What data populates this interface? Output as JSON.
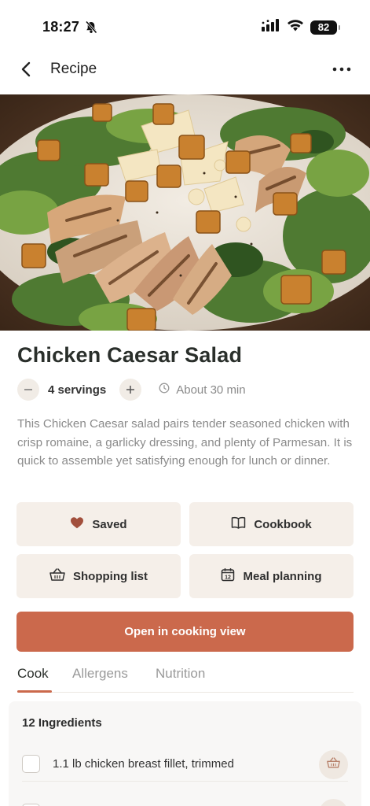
{
  "status_bar": {
    "time": "18:27",
    "battery": "82"
  },
  "nav": {
    "title": "Recipe"
  },
  "hero": {
    "image_alt": ""
  },
  "recipe": {
    "title": "Chicken Caesar Salad",
    "servings": "4 servings",
    "time": "About 30 min",
    "description": "This Chicken Caesar salad pairs tender seasoned chicken with crisp romaine, a garlicky dressing, and plenty of Parmesan. It is quick to assemble yet satisfying enough for lunch or dinner."
  },
  "actions": {
    "saved": "Saved",
    "cookbook": "Cookbook",
    "shopping_list": "Shopping list",
    "meal_planning": "Meal planning",
    "open_cooking_view": "Open in cooking view",
    "calendar_day": "12"
  },
  "tabs": [
    "Cook",
    "Allergens",
    "Nutrition"
  ],
  "ingredients": {
    "heading": "12 Ingredients",
    "items": [
      "1.1 lb chicken breast fillet, trimmed"
    ]
  },
  "colors": {
    "accent": "#cb694c",
    "button_bg": "#f5efe9",
    "heart": "#a24f3c"
  }
}
